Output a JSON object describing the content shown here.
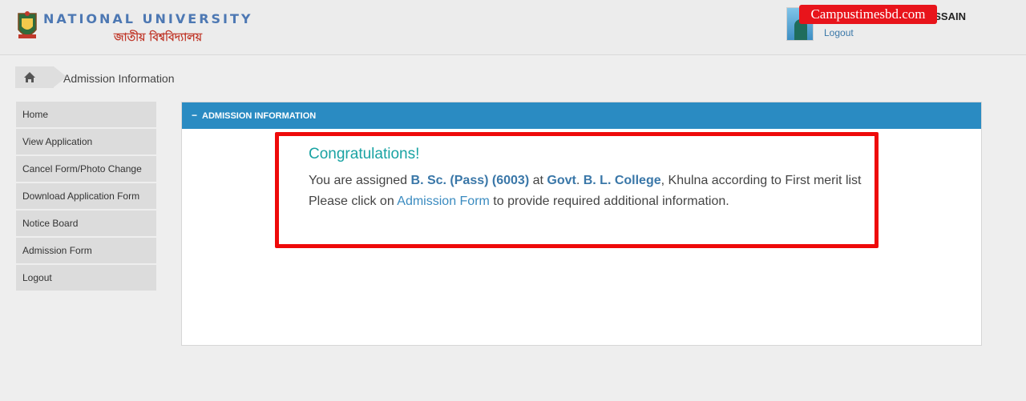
{
  "header": {
    "logo_title": "NATIONAL UNIVERSITY",
    "logo_subtitle": "জাতীয় বিশ্ববিদ্যালয়",
    "user_name_visible": "SSAIN",
    "logout_label": "Logout",
    "watermark": "Campustimesbd.com"
  },
  "breadcrumb": {
    "current": "Admission Information"
  },
  "sidebar": {
    "items": [
      {
        "label": "Home"
      },
      {
        "label": "View Application"
      },
      {
        "label": "Cancel Form/Photo Change"
      },
      {
        "label": "Download Application Form"
      },
      {
        "label": "Notice Board"
      },
      {
        "label": "Admission Form"
      },
      {
        "label": "Logout"
      }
    ]
  },
  "panel": {
    "title": "ADMISSION INFORMATION",
    "collapse_glyph": "−",
    "congrats": "Congratulations!",
    "line1_prefix": "You are assigned ",
    "subject": "B. Sc. (Pass) (6003)",
    "line1_at": " at ",
    "college_a": "Govt",
    "college_dot": ".",
    "college_b": " B. L. College",
    "line1_suffix": ", Khulna according to First merit list",
    "line2_prefix": "Please click on ",
    "admission_form_link": "Admission Form",
    "line2_suffix": " to provide required additional information."
  },
  "colors": {
    "panel_header": "#2a8bc2",
    "highlight_border": "#ee0a0a",
    "congrats": "#1aa3a3",
    "link": "#3a77a8"
  }
}
